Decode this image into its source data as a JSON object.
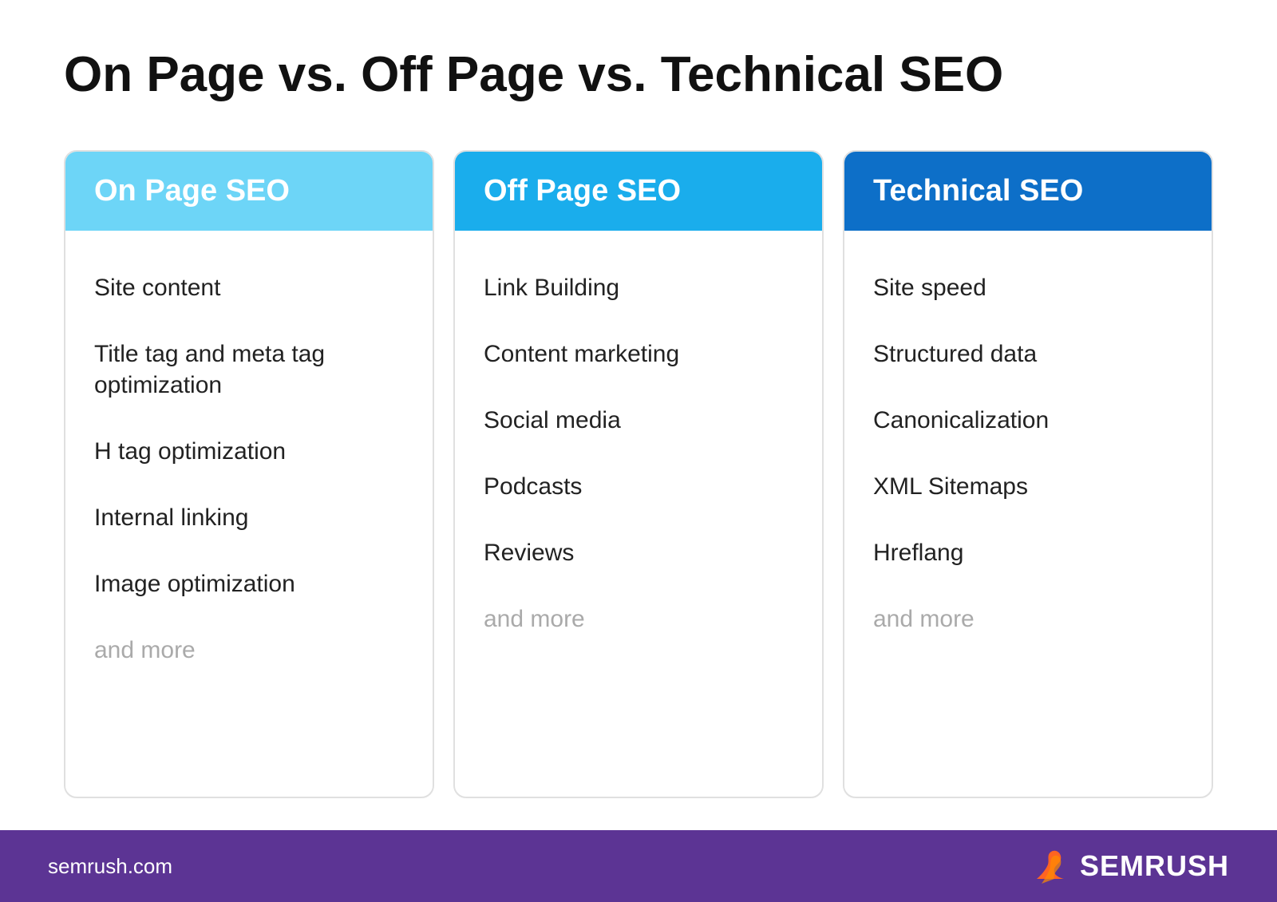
{
  "page": {
    "title": "On Page vs. Off Page vs. Technical SEO"
  },
  "columns": [
    {
      "id": "on-page",
      "header": "On Page SEO",
      "header_color": "#6dd5f7",
      "items": [
        "Site content",
        "Title tag and meta tag optimization",
        "H tag optimization",
        "Internal linking",
        "Image optimization"
      ],
      "and_more": "and more"
    },
    {
      "id": "off-page",
      "header": "Off Page SEO",
      "header_color": "#1aadec",
      "items": [
        "Link Building",
        "Content marketing",
        "Social media",
        "Podcasts",
        "Reviews"
      ],
      "and_more": "and more"
    },
    {
      "id": "technical",
      "header": "Technical SEO",
      "header_color": "#0d6fc8",
      "items": [
        "Site speed",
        "Structured data",
        "Canonicalization",
        "XML Sitemaps",
        "Hreflang"
      ],
      "and_more": "and more"
    }
  ],
  "footer": {
    "url": "semrush.com",
    "brand": "SEMRUSH"
  }
}
